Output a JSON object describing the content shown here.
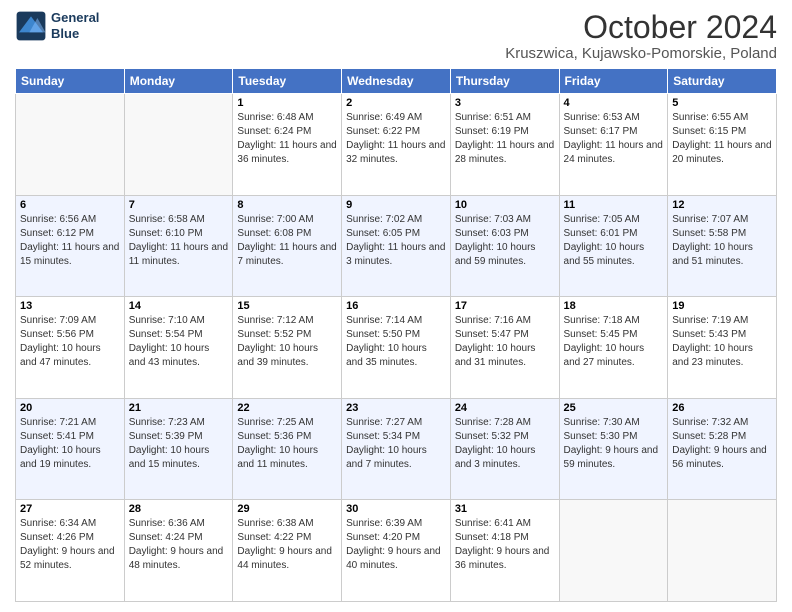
{
  "logo": {
    "line1": "General",
    "line2": "Blue"
  },
  "title": "October 2024",
  "subtitle": "Kruszwica, Kujawsko-Pomorskie, Poland",
  "days_of_week": [
    "Sunday",
    "Monday",
    "Tuesday",
    "Wednesday",
    "Thursday",
    "Friday",
    "Saturday"
  ],
  "weeks": [
    [
      {
        "day": "",
        "info": ""
      },
      {
        "day": "",
        "info": ""
      },
      {
        "day": "1",
        "info": "Sunrise: 6:48 AM\nSunset: 6:24 PM\nDaylight: 11 hours and 36 minutes."
      },
      {
        "day": "2",
        "info": "Sunrise: 6:49 AM\nSunset: 6:22 PM\nDaylight: 11 hours and 32 minutes."
      },
      {
        "day": "3",
        "info": "Sunrise: 6:51 AM\nSunset: 6:19 PM\nDaylight: 11 hours and 28 minutes."
      },
      {
        "day": "4",
        "info": "Sunrise: 6:53 AM\nSunset: 6:17 PM\nDaylight: 11 hours and 24 minutes."
      },
      {
        "day": "5",
        "info": "Sunrise: 6:55 AM\nSunset: 6:15 PM\nDaylight: 11 hours and 20 minutes."
      }
    ],
    [
      {
        "day": "6",
        "info": "Sunrise: 6:56 AM\nSunset: 6:12 PM\nDaylight: 11 hours and 15 minutes."
      },
      {
        "day": "7",
        "info": "Sunrise: 6:58 AM\nSunset: 6:10 PM\nDaylight: 11 hours and 11 minutes."
      },
      {
        "day": "8",
        "info": "Sunrise: 7:00 AM\nSunset: 6:08 PM\nDaylight: 11 hours and 7 minutes."
      },
      {
        "day": "9",
        "info": "Sunrise: 7:02 AM\nSunset: 6:05 PM\nDaylight: 11 hours and 3 minutes."
      },
      {
        "day": "10",
        "info": "Sunrise: 7:03 AM\nSunset: 6:03 PM\nDaylight: 10 hours and 59 minutes."
      },
      {
        "day": "11",
        "info": "Sunrise: 7:05 AM\nSunset: 6:01 PM\nDaylight: 10 hours and 55 minutes."
      },
      {
        "day": "12",
        "info": "Sunrise: 7:07 AM\nSunset: 5:58 PM\nDaylight: 10 hours and 51 minutes."
      }
    ],
    [
      {
        "day": "13",
        "info": "Sunrise: 7:09 AM\nSunset: 5:56 PM\nDaylight: 10 hours and 47 minutes."
      },
      {
        "day": "14",
        "info": "Sunrise: 7:10 AM\nSunset: 5:54 PM\nDaylight: 10 hours and 43 minutes."
      },
      {
        "day": "15",
        "info": "Sunrise: 7:12 AM\nSunset: 5:52 PM\nDaylight: 10 hours and 39 minutes."
      },
      {
        "day": "16",
        "info": "Sunrise: 7:14 AM\nSunset: 5:50 PM\nDaylight: 10 hours and 35 minutes."
      },
      {
        "day": "17",
        "info": "Sunrise: 7:16 AM\nSunset: 5:47 PM\nDaylight: 10 hours and 31 minutes."
      },
      {
        "day": "18",
        "info": "Sunrise: 7:18 AM\nSunset: 5:45 PM\nDaylight: 10 hours and 27 minutes."
      },
      {
        "day": "19",
        "info": "Sunrise: 7:19 AM\nSunset: 5:43 PM\nDaylight: 10 hours and 23 minutes."
      }
    ],
    [
      {
        "day": "20",
        "info": "Sunrise: 7:21 AM\nSunset: 5:41 PM\nDaylight: 10 hours and 19 minutes."
      },
      {
        "day": "21",
        "info": "Sunrise: 7:23 AM\nSunset: 5:39 PM\nDaylight: 10 hours and 15 minutes."
      },
      {
        "day": "22",
        "info": "Sunrise: 7:25 AM\nSunset: 5:36 PM\nDaylight: 10 hours and 11 minutes."
      },
      {
        "day": "23",
        "info": "Sunrise: 7:27 AM\nSunset: 5:34 PM\nDaylight: 10 hours and 7 minutes."
      },
      {
        "day": "24",
        "info": "Sunrise: 7:28 AM\nSunset: 5:32 PM\nDaylight: 10 hours and 3 minutes."
      },
      {
        "day": "25",
        "info": "Sunrise: 7:30 AM\nSunset: 5:30 PM\nDaylight: 9 hours and 59 minutes."
      },
      {
        "day": "26",
        "info": "Sunrise: 7:32 AM\nSunset: 5:28 PM\nDaylight: 9 hours and 56 minutes."
      }
    ],
    [
      {
        "day": "27",
        "info": "Sunrise: 6:34 AM\nSunset: 4:26 PM\nDaylight: 9 hours and 52 minutes."
      },
      {
        "day": "28",
        "info": "Sunrise: 6:36 AM\nSunset: 4:24 PM\nDaylight: 9 hours and 48 minutes."
      },
      {
        "day": "29",
        "info": "Sunrise: 6:38 AM\nSunset: 4:22 PM\nDaylight: 9 hours and 44 minutes."
      },
      {
        "day": "30",
        "info": "Sunrise: 6:39 AM\nSunset: 4:20 PM\nDaylight: 9 hours and 40 minutes."
      },
      {
        "day": "31",
        "info": "Sunrise: 6:41 AM\nSunset: 4:18 PM\nDaylight: 9 hours and 36 minutes."
      },
      {
        "day": "",
        "info": ""
      },
      {
        "day": "",
        "info": ""
      }
    ]
  ]
}
